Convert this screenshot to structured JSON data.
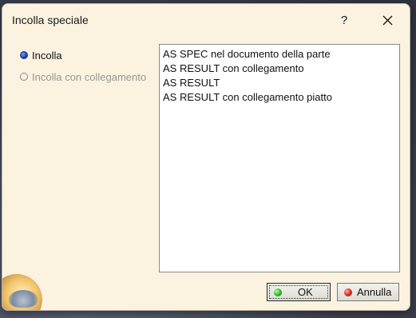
{
  "window": {
    "title": "Incolla speciale",
    "help_label": "?"
  },
  "options": {
    "items": [
      {
        "label": "Incolla",
        "checked": true,
        "enabled": true
      },
      {
        "label": "Incolla con collegamento",
        "checked": false,
        "enabled": false
      }
    ]
  },
  "formats": {
    "items": [
      "AS SPEC nel documento della parte",
      "AS RESULT con collegamento",
      "AS RESULT",
      "AS RESULT con collegamento piatto"
    ]
  },
  "buttons": {
    "ok_label": "OK",
    "cancel_label": "Annulla"
  },
  "icons": {
    "close": "close-icon",
    "help": "help-icon",
    "ok_status": "green-led-icon",
    "cancel_status": "red-led-icon",
    "logo": "catia-logo-icon"
  }
}
